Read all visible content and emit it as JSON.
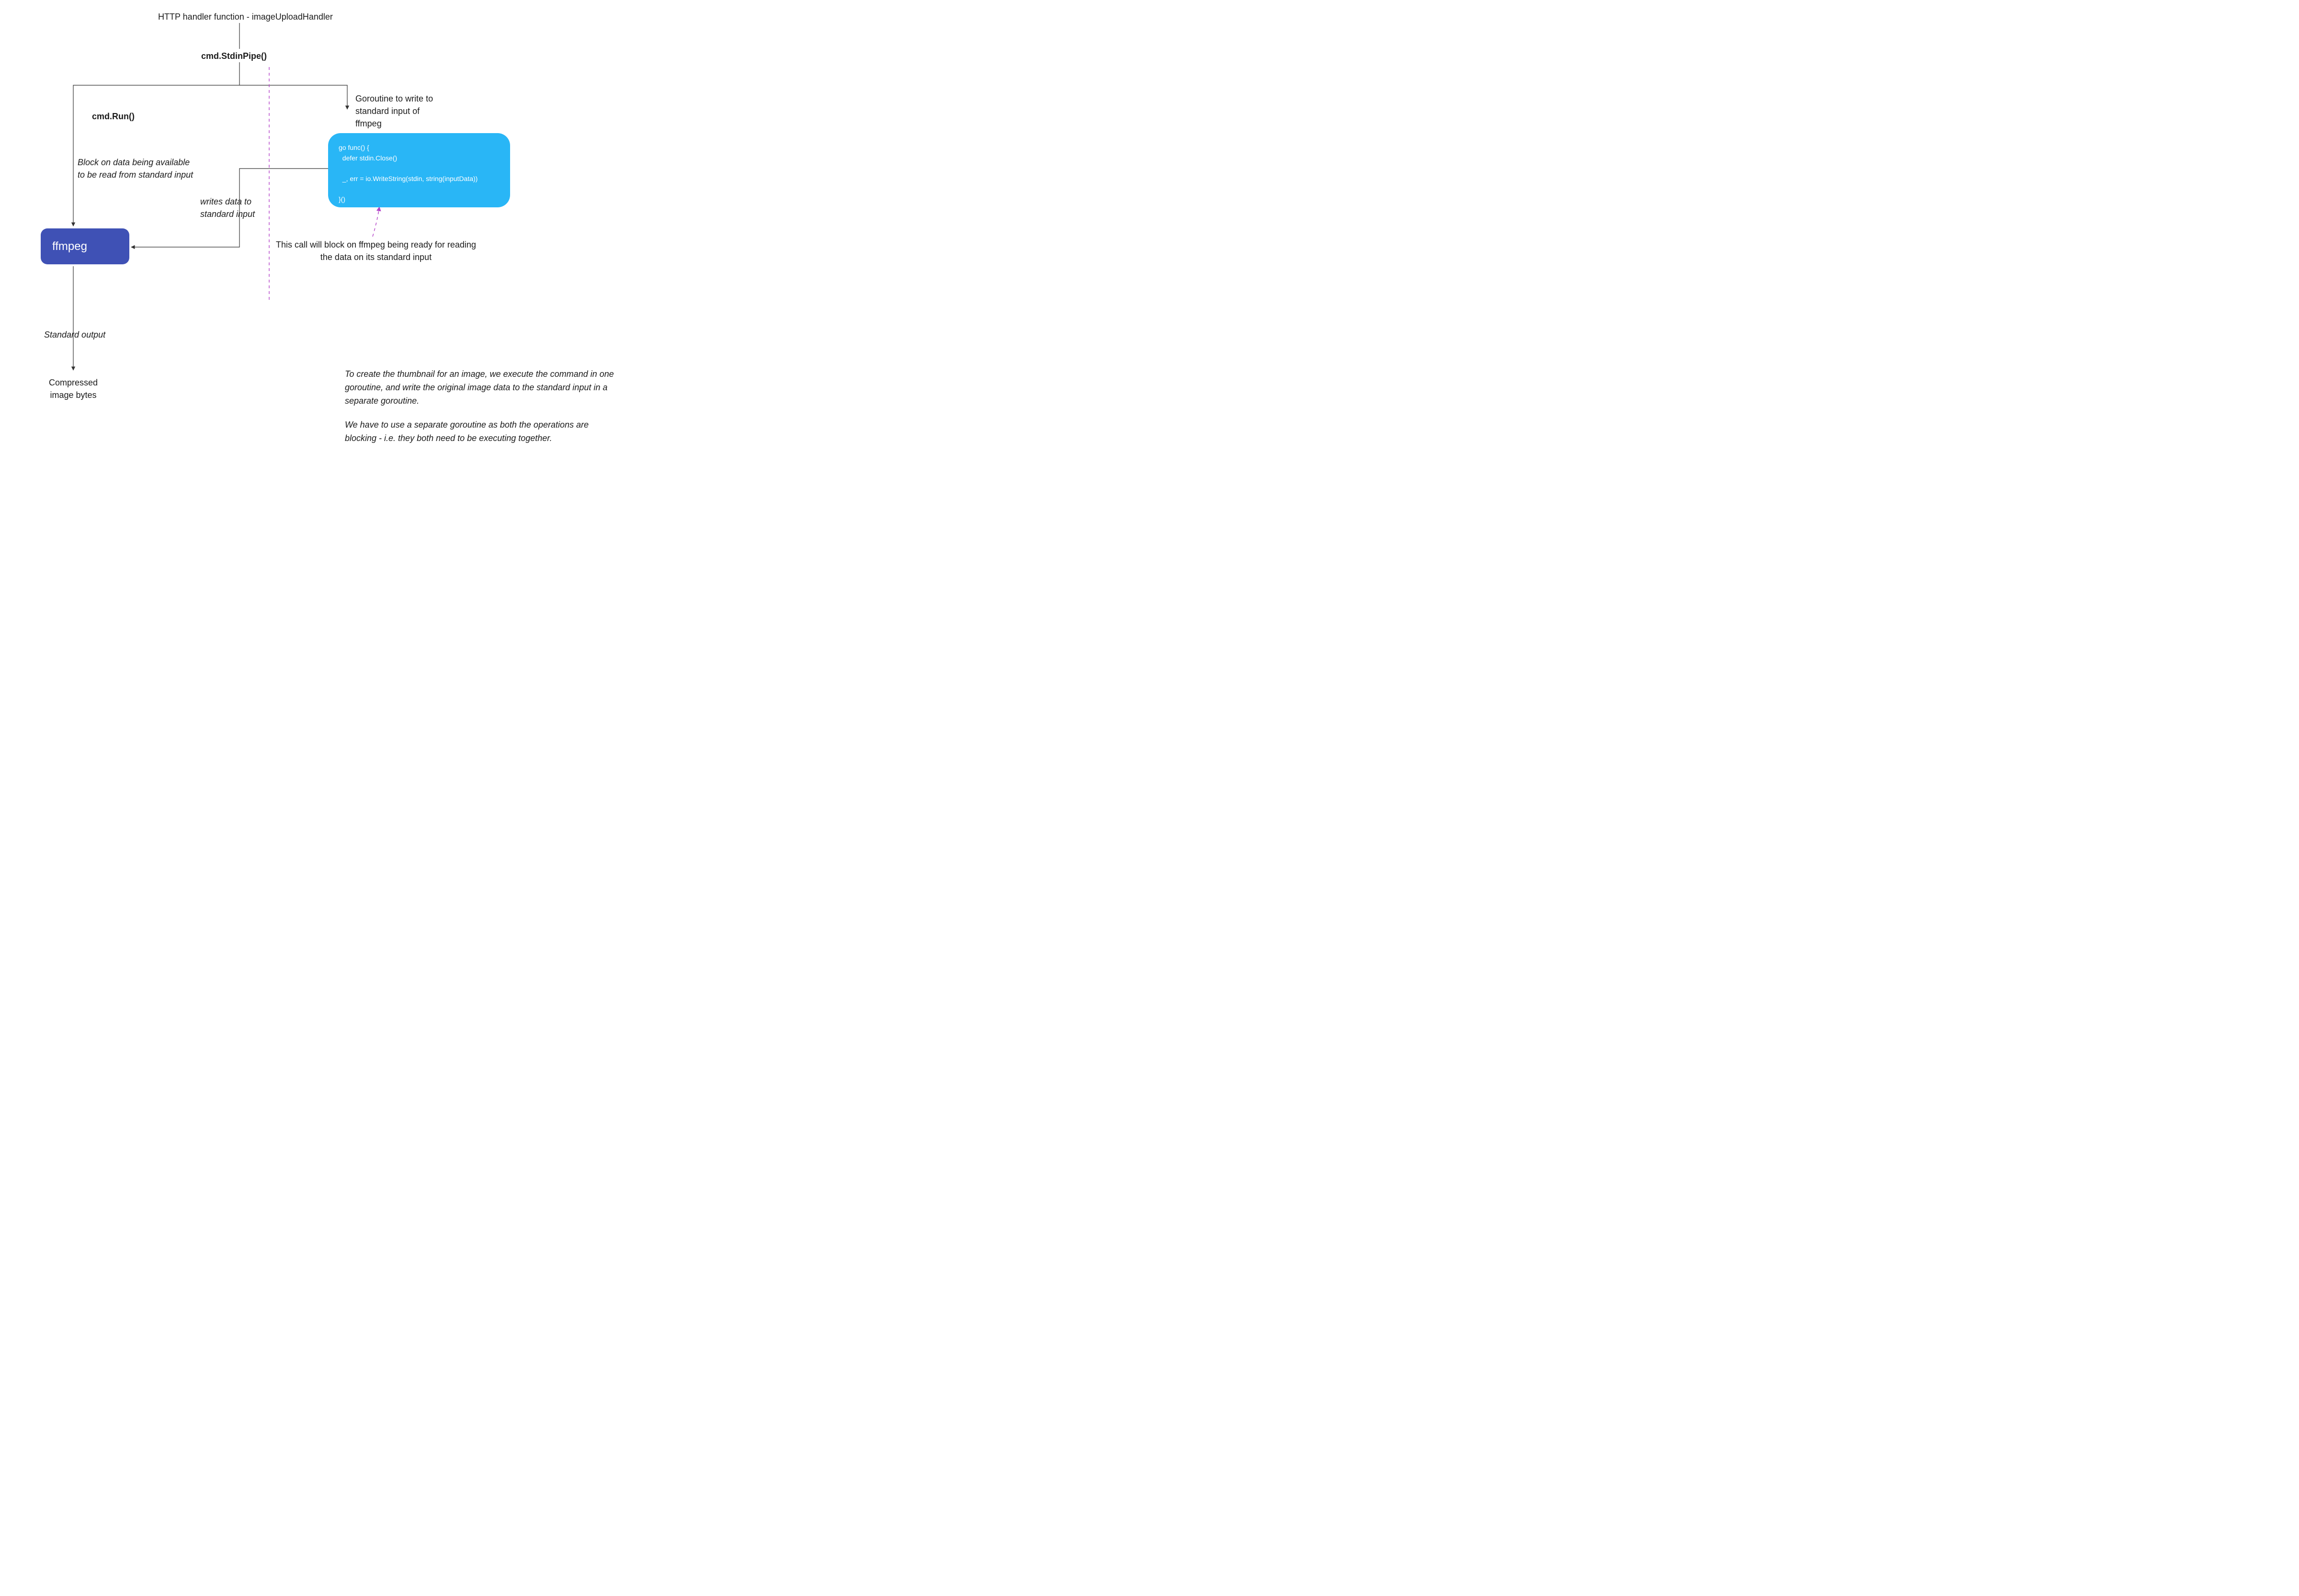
{
  "title": {
    "prefix": "HTTP handler function - ",
    "suffix_italic": "imageUploadHandler"
  },
  "edges": {
    "stdin_pipe": "cmd.StdinPipe()",
    "run": "cmd.Run()",
    "block_read_l1": "Block on data being available",
    "block_read_l2": "to be read from standard input",
    "writes_l1": "writes data to",
    "writes_l2": "standard input",
    "std_output": "Standard output",
    "compressed_l1": "Compressed",
    "compressed_l2": "image bytes",
    "goroutine_l1": "Goroutine to write to",
    "goroutine_l2": "standard input of",
    "goroutine_l3": "ffmpeg"
  },
  "ffmpeg_node": "ffmpeg",
  "code": {
    "l1": "go func() {",
    "l2": "  defer stdin.Close()",
    "l3": "",
    "l4": "  _, err = io.WriteString(stdin, string(inputData))",
    "l5": "",
    "l6": "}()"
  },
  "callout": {
    "prefix": "This call will block on ",
    "italic": "ffmpeg",
    "suffix": " being ready for reading",
    "line2": "the data on its standard input"
  },
  "explanation": {
    "p1": "To create the thumbnail for an image, we execute the command in one goroutine, and write the original image data to the standard input in a separate goroutine.",
    "p2": "We have to use a separate goroutine as both the operations are blocking - i.e. they both need to be executing together."
  },
  "colors": {
    "ffmpeg_box": "#3f51b5",
    "code_box": "#29b6f6",
    "wire": "#333333",
    "dashed": "#b342c9"
  }
}
